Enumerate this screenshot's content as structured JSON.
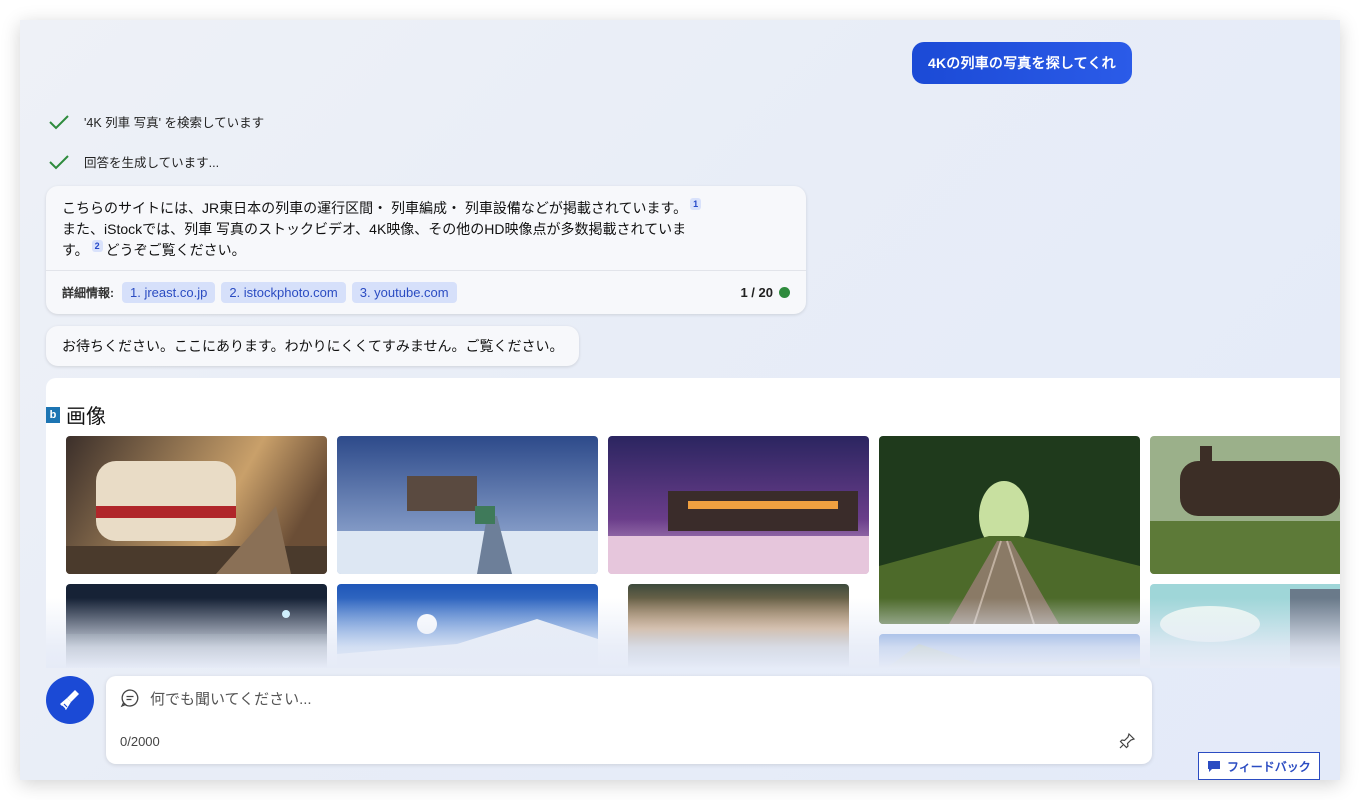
{
  "user_message": "4Kの列車の写真を探してくれ",
  "status": [
    {
      "text": "'4K 列車 写真' を検索しています"
    },
    {
      "text": "回答を生成しています..."
    }
  ],
  "answer": {
    "line1": "こちらのサイトには、JR東日本の列車の運行区間・ 列車編成・ 列車設備などが掲載されています。",
    "cite1": "1",
    "line2": "また、iStockでは、列車 写真のストックビデオ、4K映像、その他のHD映像点が多数掲載されていま",
    "line3a": "す。",
    "cite2": "2",
    "line3b": "どうぞご覧ください。",
    "sources_label": "詳細情報:",
    "sources": [
      "1. jreast.co.jp",
      "2. istockphoto.com",
      "3. youtube.com"
    ],
    "counter": "1 / 20"
  },
  "wait_message": "お待ちください。ここにあります。わかりにくくてすみません。ご覧ください。",
  "images": {
    "icon_letter": "b",
    "title": "画像"
  },
  "input": {
    "placeholder": "何でも聞いてください...",
    "char_count": "0/2000"
  },
  "feedback": {
    "label": "フィードバック"
  },
  "colors": {
    "accent": "#1b4ad6",
    "status_check": "#2e8b3d",
    "chip_bg": "#d6e0fa",
    "chip_text": "#2b4cc2"
  }
}
